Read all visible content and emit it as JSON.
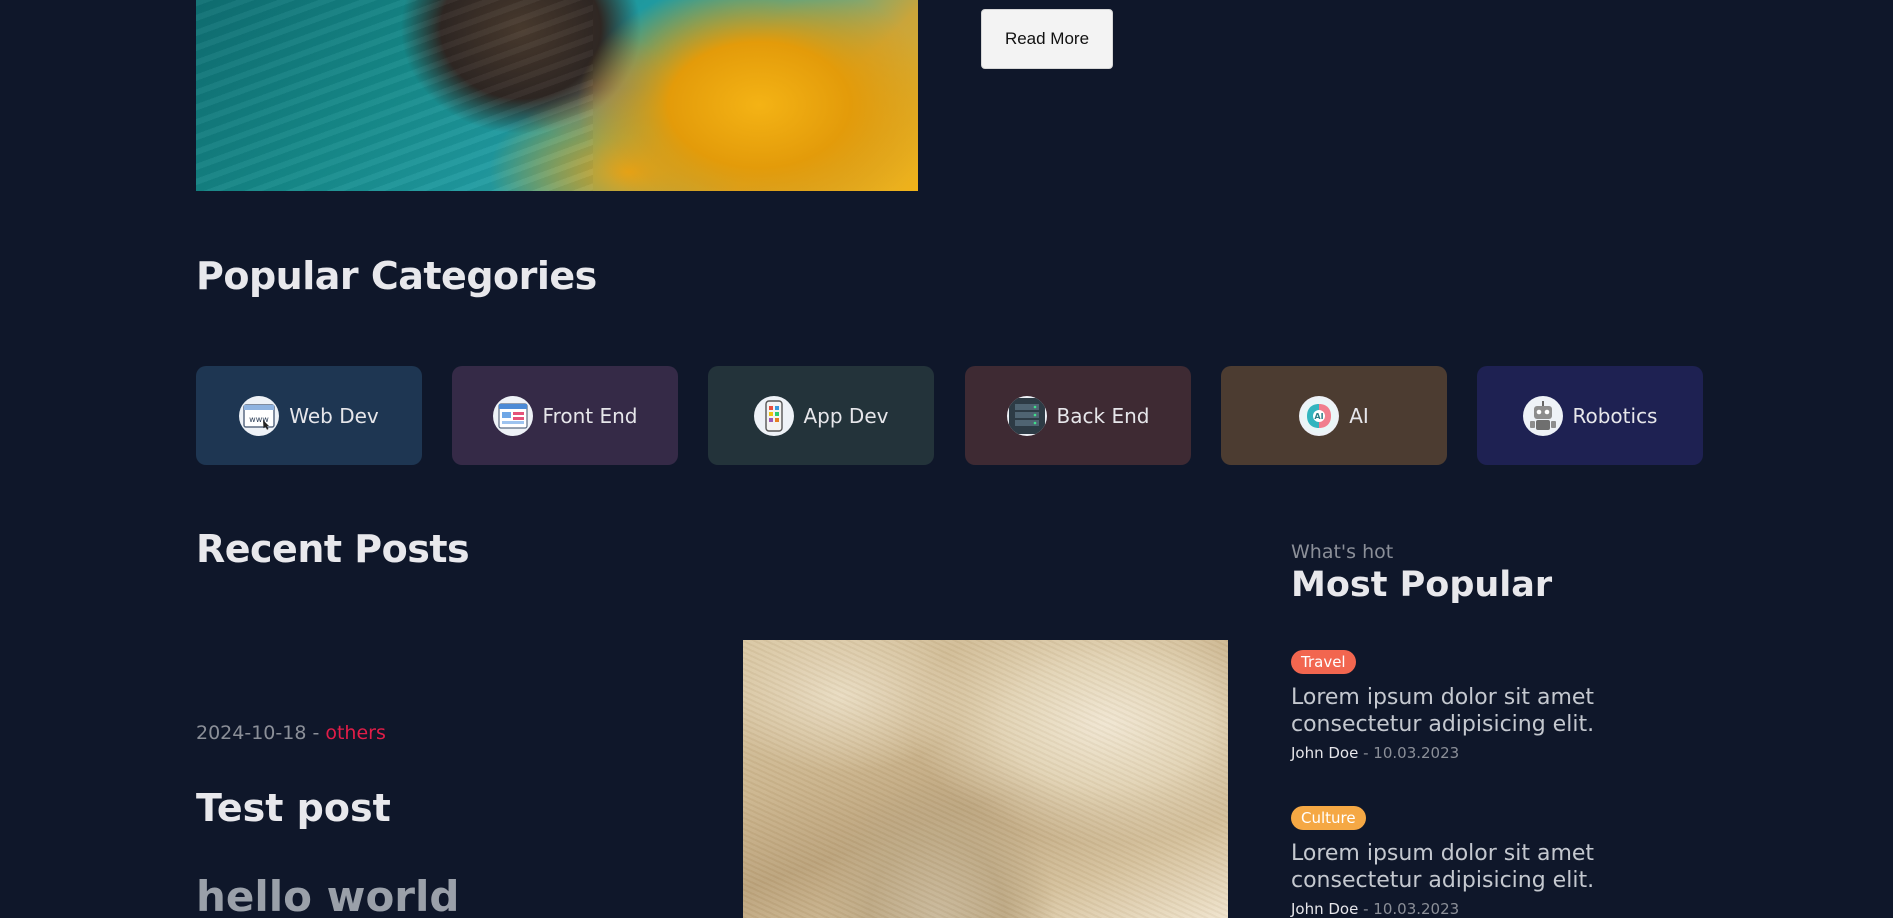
{
  "hero": {
    "read_more_label": "Read More"
  },
  "categories": {
    "title": "Popular Categories",
    "items": [
      {
        "label": "Web Dev",
        "icon": "www-browser-icon",
        "color": "#1e3652"
      },
      {
        "label": "Front End",
        "icon": "code-window-icon",
        "color": "#352a47"
      },
      {
        "label": "App Dev",
        "icon": "mobile-app-icon",
        "color": "#23333a"
      },
      {
        "label": "Back End",
        "icon": "server-icon",
        "color": "#3e2a33"
      },
      {
        "label": "AI",
        "icon": "brain-icon",
        "color": "#4c3c31"
      },
      {
        "label": "Robotics",
        "icon": "robot-icon",
        "color": "#1e2152"
      }
    ]
  },
  "recent": {
    "title": "Recent Posts",
    "post": {
      "date": "2024-10-18",
      "separator": " - ",
      "category": "others",
      "title": "Test post",
      "excerpt": "hello world"
    }
  },
  "sidebar": {
    "kicker": "What's hot",
    "title": "Most Popular",
    "items": [
      {
        "tag": "Travel",
        "tag_color": "#f2664f",
        "title": "Lorem ipsum dolor sit amet consectetur adipisicing elit.",
        "author": "John Doe",
        "date": "10.03.2023",
        "separator": " - "
      },
      {
        "tag": "Culture",
        "tag_color": "#f5a844",
        "title": "Lorem ipsum dolor sit amet consectetur adipisicing elit.",
        "author": "John Doe",
        "date": "10.03.2023",
        "separator": " - "
      }
    ]
  },
  "colors": {
    "background": "#0f172a",
    "accent": "#e11d48"
  }
}
